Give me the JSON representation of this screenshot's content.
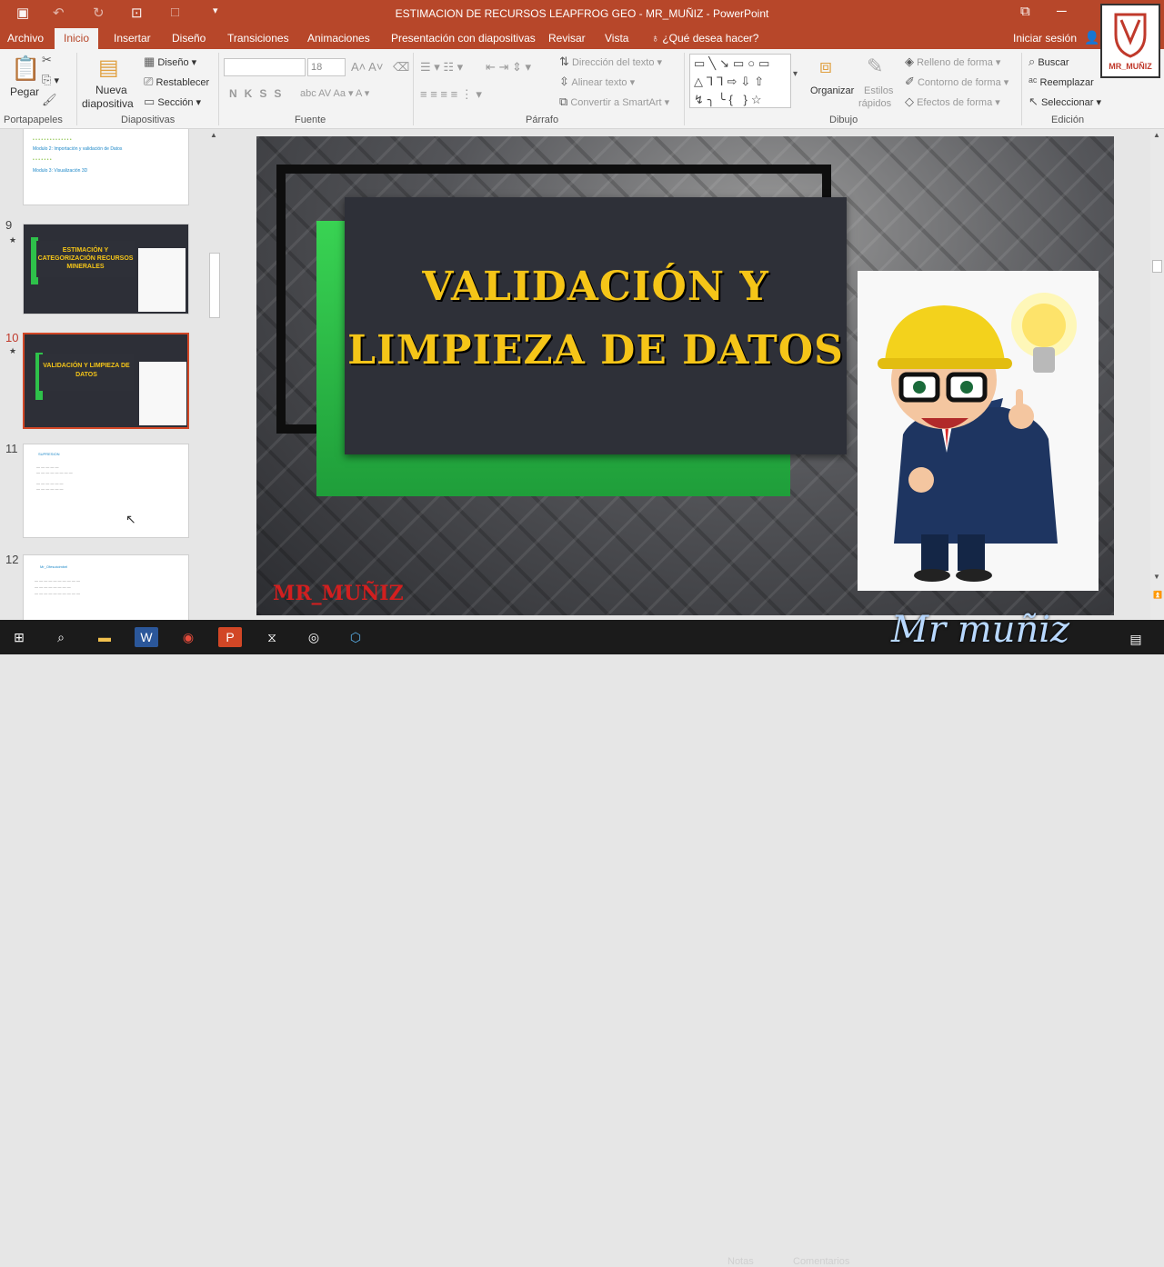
{
  "window": {
    "title": "ESTIMACION DE RECURSOS LEAPFROG GEO  -  MR_MUÑIZ - PowerPoint",
    "sign_in": "Iniciar sesión",
    "tell_me": "¿Qué desea hacer?"
  },
  "tabs": [
    {
      "label": "Archivo"
    },
    {
      "label": "Inicio"
    },
    {
      "label": "Insertar"
    },
    {
      "label": "Diseño"
    },
    {
      "label": "Transiciones"
    },
    {
      "label": "Animaciones"
    },
    {
      "label": "Presentación con diapositivas"
    },
    {
      "label": "Revisar"
    },
    {
      "label": "Vista"
    }
  ],
  "ribbon": {
    "paste": "Pegar",
    "portapapeles": "Portapapeles",
    "new_slide_1": "Nueva",
    "new_slide_2": "diapositiva",
    "layout": "Diseño",
    "reset": "Restablecer",
    "section": "Sección",
    "diapositivas": "Diapositivas",
    "font_size": "18",
    "fuente": "Fuente",
    "text_direction": "Dirección del texto",
    "align_text": "Alinear texto",
    "smartart": "Convertir a SmartArt",
    "parrafo": "Párrafo",
    "arrange": "Organizar",
    "quick_styles_1": "Estilos",
    "quick_styles_2": "rápidos",
    "shape_fill": "Relleno de forma",
    "shape_outline": "Contorno de forma",
    "shape_effects": "Efectos de forma",
    "dibujo": "Dibujo",
    "find": "Buscar",
    "replace": "Reemplazar",
    "select": "Seleccionar",
    "edicion": "Edición"
  },
  "thumbnails": {
    "n9": "9",
    "n10": "10",
    "n11": "11",
    "n12": "12",
    "t8_heading1": "Modulo 2: Importación y validación de Datos",
    "t8_heading2": "Modulo 3: Visualización 3D",
    "t9_title": "ESTIMACIÓN Y CATEGORIZACIÓN RECURSOS MINERALES",
    "t10_title": "VALIDACIÓN Y LIMPIEZA DE DATOS",
    "t11_title": "SUPRESION",
    "t12_title": "Mr_Ofesutcimbel"
  },
  "slide": {
    "title_line1": "VALIDACIÓN Y",
    "title_line2": "LIMPIEZA DE DATOS",
    "logo": "MR_MUÑIZ"
  },
  "brand_badge": "MR_MUÑIZ",
  "watermark": "Mr muñiz",
  "status": {
    "notes": "Notas",
    "comments": "Comentarios"
  }
}
